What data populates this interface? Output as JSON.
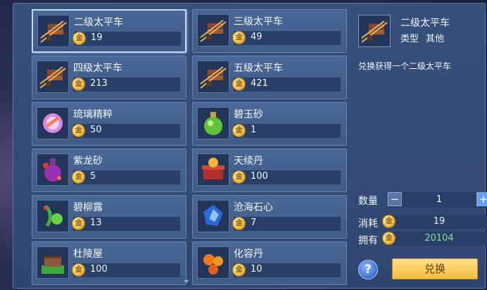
{
  "items": [
    {
      "name": "二级太平车",
      "price": "19",
      "icon": "cart-icon",
      "selected": true
    },
    {
      "name": "三级太平车",
      "price": "49",
      "icon": "cart-icon"
    },
    {
      "name": "四级太平车",
      "price": "213",
      "icon": "cart-icon"
    },
    {
      "name": "五级太平车",
      "price": "421",
      "icon": "cart-icon"
    },
    {
      "name": "琉璃精粹",
      "price": "50",
      "icon": "glass-essence-icon"
    },
    {
      "name": "碧玉砂",
      "price": "1",
      "icon": "green-potion-icon"
    },
    {
      "name": "紫龙砂",
      "price": "5",
      "icon": "purple-flask-icon"
    },
    {
      "name": "天续丹",
      "price": "100",
      "icon": "gift-box-icon"
    },
    {
      "name": "碧柳露",
      "price": "13",
      "icon": "willow-dew-icon"
    },
    {
      "name": "沧海石心",
      "price": "7",
      "icon": "blue-gem-icon"
    },
    {
      "name": "杜陵屋",
      "price": "100",
      "icon": "cottage-icon"
    },
    {
      "name": "化容丹",
      "price": "10",
      "icon": "orange-pills-icon"
    }
  ],
  "coin_glyph": "金",
  "detail": {
    "name": "二级太平车",
    "type_label": "类型",
    "type_value": "其他",
    "description": "兑换获得一个二级太平车",
    "quantity_label": "数量",
    "quantity": "1",
    "minus": "−",
    "plus": "+",
    "cost_label": "消耗",
    "cost": "19",
    "own_label": "拥有",
    "own": "20104",
    "help": "?",
    "exchange_label": "兑换"
  },
  "scroll_indicator": "⌄",
  "colors": {
    "own_value": "#7fe0a2",
    "button": "#f4bd3a",
    "panel": "#36507c"
  }
}
